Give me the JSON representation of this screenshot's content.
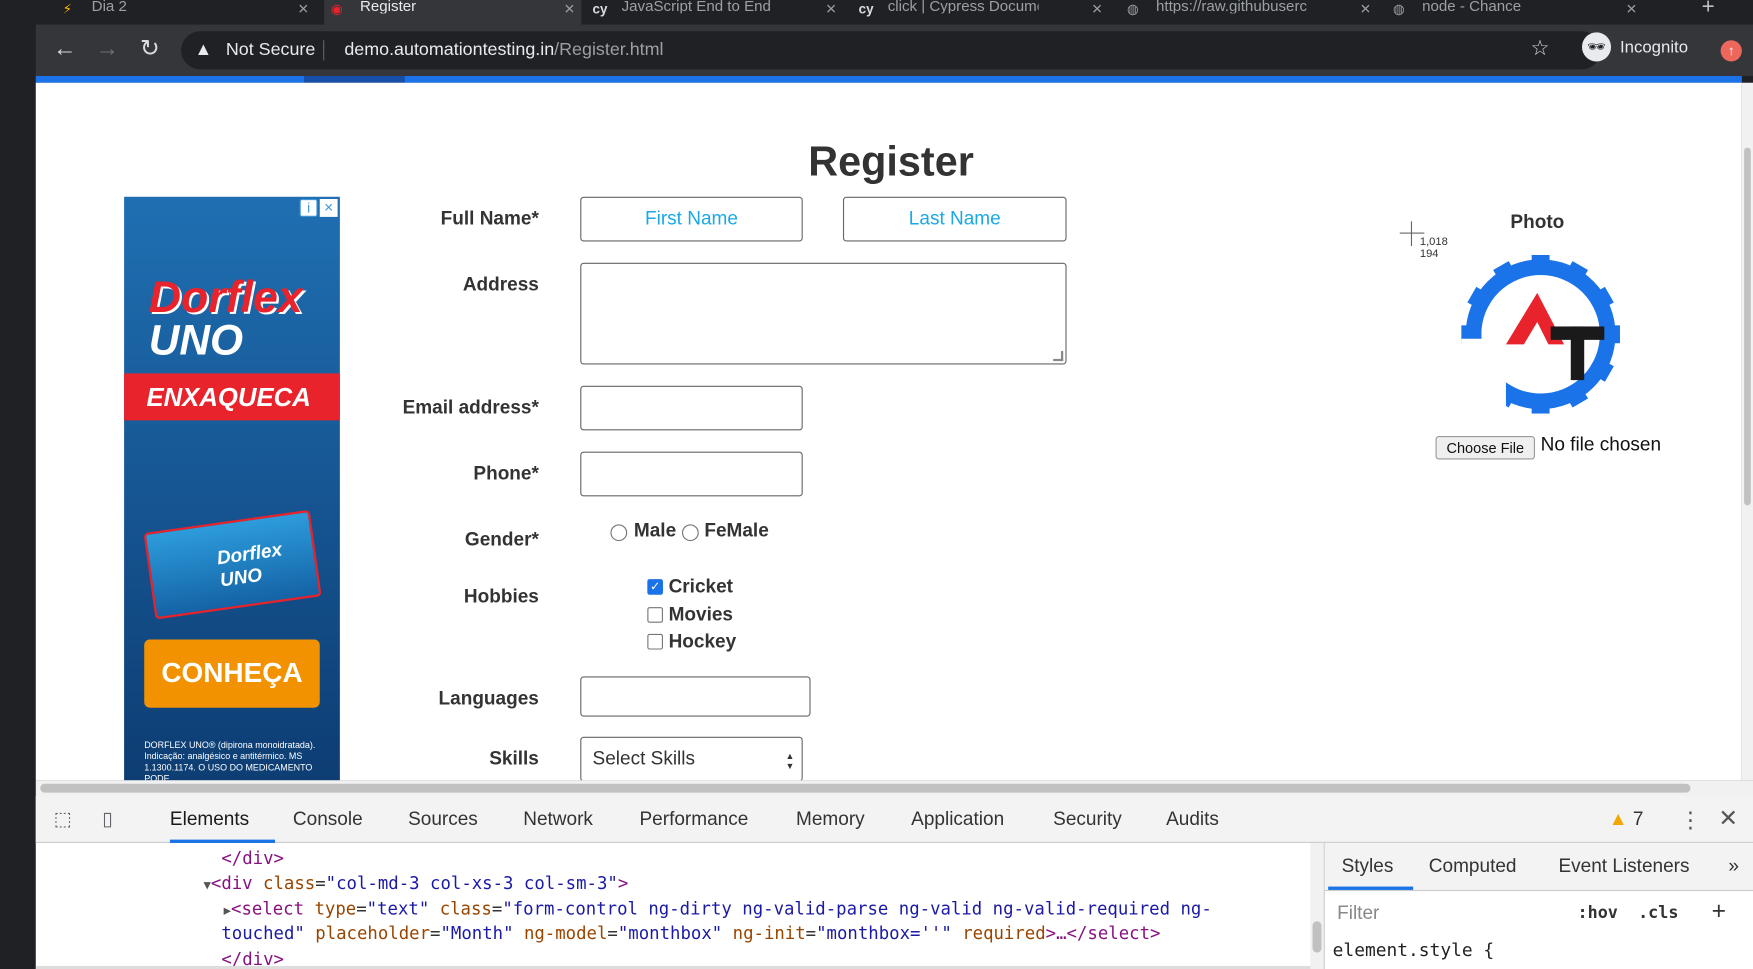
{
  "tabs": [
    {
      "label": "Dia 2",
      "icon": "bolt-icon",
      "active": false
    },
    {
      "label": "Register",
      "icon": "at-logo-icon",
      "active": true
    },
    {
      "label": "JavaScript End to End Te",
      "icon": "cy-icon",
      "active": false
    },
    {
      "label": "click | Cypress Documen",
      "icon": "cy-icon",
      "active": false
    },
    {
      "label": "https://raw.githubuserco",
      "icon": "globe-icon",
      "active": false
    },
    {
      "label": "node - Chance",
      "icon": "globe-icon",
      "active": false
    }
  ],
  "toolbar": {
    "security_label": "Not Secure",
    "url_host": "demo.automationtesting.in",
    "url_path": "/Register.html",
    "profile_label": "Incognito"
  },
  "page": {
    "title": "Register",
    "form": {
      "full_name_label": "Full Name*",
      "first_name_placeholder": "First Name",
      "last_name_placeholder": "Last Name",
      "address_label": "Address",
      "email_label": "Email address*",
      "phone_label": "Phone*",
      "gender_label": "Gender*",
      "gender_options": [
        "Male",
        "FeMale"
      ],
      "hobbies_label": "Hobbies",
      "hobbies": [
        {
          "label": "Cricket",
          "checked": true
        },
        {
          "label": "Movies",
          "checked": false
        },
        {
          "label": "Hockey",
          "checked": false
        }
      ],
      "languages_label": "Languages",
      "skills_label": "Skills",
      "skills_selected": "Select Skills"
    },
    "photo": {
      "label": "Photo",
      "choose_file_label": "Choose File",
      "file_status": "No file chosen"
    },
    "cursor_readout": [
      "1,018",
      "194"
    ],
    "ad": {
      "brand_line1": "Dorflex",
      "brand_line2": "UNO",
      "band_text": "ENXAQUECA",
      "pack_text": "Dorflex UNO",
      "cta": "CONHEÇA",
      "fine_print": "DORFLEX UNO® (dipirona monoidratada). Indicação: analgésico e antitérmico. MS 1.1300.1174. O USO DO MEDICAMENTO PODE"
    }
  },
  "devtools": {
    "tabs": [
      "Elements",
      "Console",
      "Sources",
      "Network",
      "Performance",
      "Memory",
      "Application",
      "Security",
      "Audits"
    ],
    "active_tab": "Elements",
    "warning_count": "7",
    "code_lines": {
      "l1": "</div>",
      "l2_tag": "<div ",
      "l2_attr": "class",
      "l2_val": "\"col-md-3 col-xs-3 col-sm-3\"",
      "l2_end": ">",
      "l3_tag": "<select ",
      "l3_a1": "type",
      "l3_v1": "\"text\"",
      "l3_a2": " class",
      "l3_v2": "\"form-control ng-dirty ng-valid-parse ng-valid ng-valid-required ng-",
      "l4_v2": "touched\"",
      "l4_a3": " placeholder",
      "l4_v3": "\"Month\"",
      "l4_a4": " ng-model",
      "l4_v4": "\"monthbox\"",
      "l4_a5": " ng-init",
      "l4_v5": "\"monthbox=''\"",
      "l4_a6": " required",
      "l4_end": ">…</select>",
      "l5": "</div>"
    },
    "styles_tabs": [
      "Styles",
      "Computed",
      "Event Listeners"
    ],
    "filter_placeholder": "Filter",
    "hov": ":hov",
    "cls": ".cls",
    "element_style": "element.style {"
  },
  "colors": {
    "accent": "#1a73e8",
    "link_placeholder": "#1aa8e6",
    "ad_red": "#e8232c",
    "ad_orange": "#f39200"
  }
}
